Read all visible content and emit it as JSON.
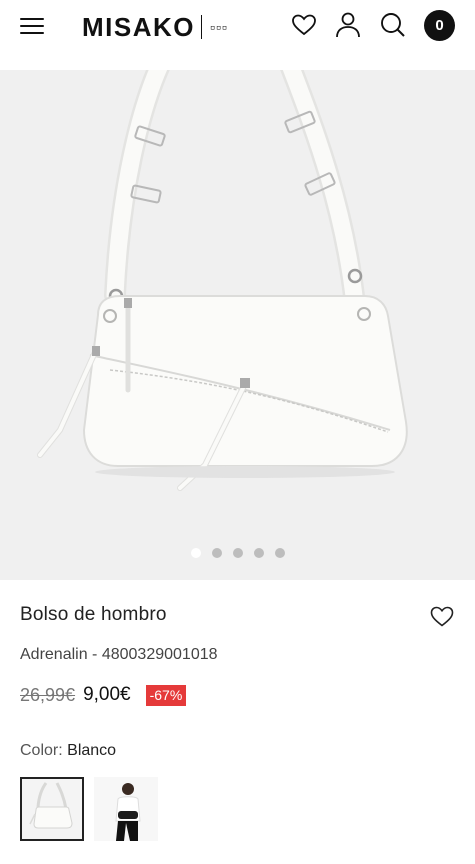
{
  "header": {
    "brand": "MISAKO",
    "brand_sub": "▫▫▫",
    "cart_count": "0",
    "icons": [
      "menu-icon",
      "heart-icon",
      "user-icon",
      "search-icon",
      "cart-icon"
    ]
  },
  "gallery": {
    "slides_total": 5,
    "active_slide": 1,
    "background": "#f0f0f0"
  },
  "product": {
    "title": "Bolso de hombro",
    "ref_brand": "Adrenalin",
    "ref_sep": " - ",
    "ref_code": "4800329001018",
    "old_price": "26,99€",
    "price": "9,00€",
    "discount": "-67%",
    "color_label": "Color:",
    "color_value": "Blanco"
  },
  "colors": {
    "discount_bg": "#e53a3a",
    "text": "#222222"
  }
}
